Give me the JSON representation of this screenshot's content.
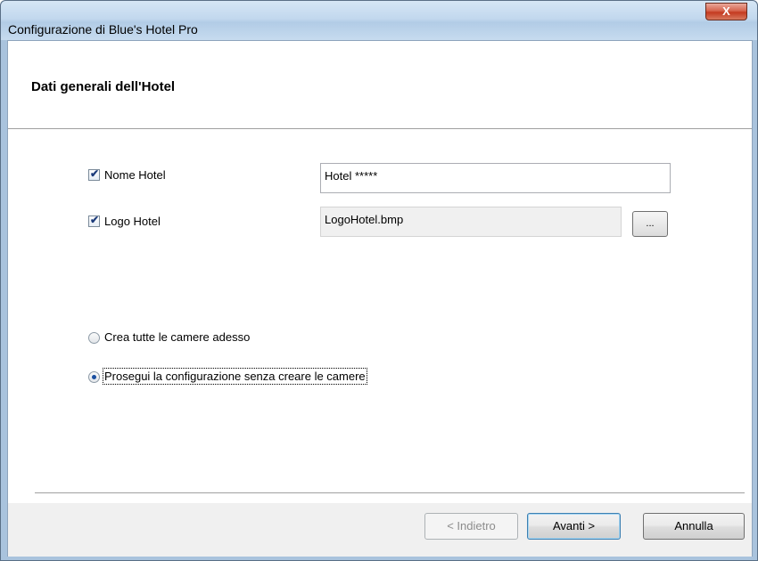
{
  "window": {
    "title": "Configurazione di Blue's Hotel Pro",
    "close_glyph": "X"
  },
  "header": {
    "title": "Dati generali dell'Hotel"
  },
  "fields": {
    "nome_hotel": {
      "label": "Nome Hotel",
      "checked": true,
      "value": "Hotel *****"
    },
    "logo_hotel": {
      "label": "Logo Hotel",
      "checked": true,
      "value": "LogoHotel.bmp",
      "browse_label": "..."
    }
  },
  "options": {
    "crea_camere": {
      "label": "Crea tutte le camere adesso",
      "selected": false
    },
    "prosegui": {
      "label": "Prosegui la configurazione senza creare le camere",
      "selected": true
    }
  },
  "buttons": {
    "back_label": "< Indietro",
    "next_label": "Avanti >",
    "cancel_label": "Annulla"
  },
  "icons": {
    "checkmark": "check-icon",
    "close": "close-icon"
  }
}
